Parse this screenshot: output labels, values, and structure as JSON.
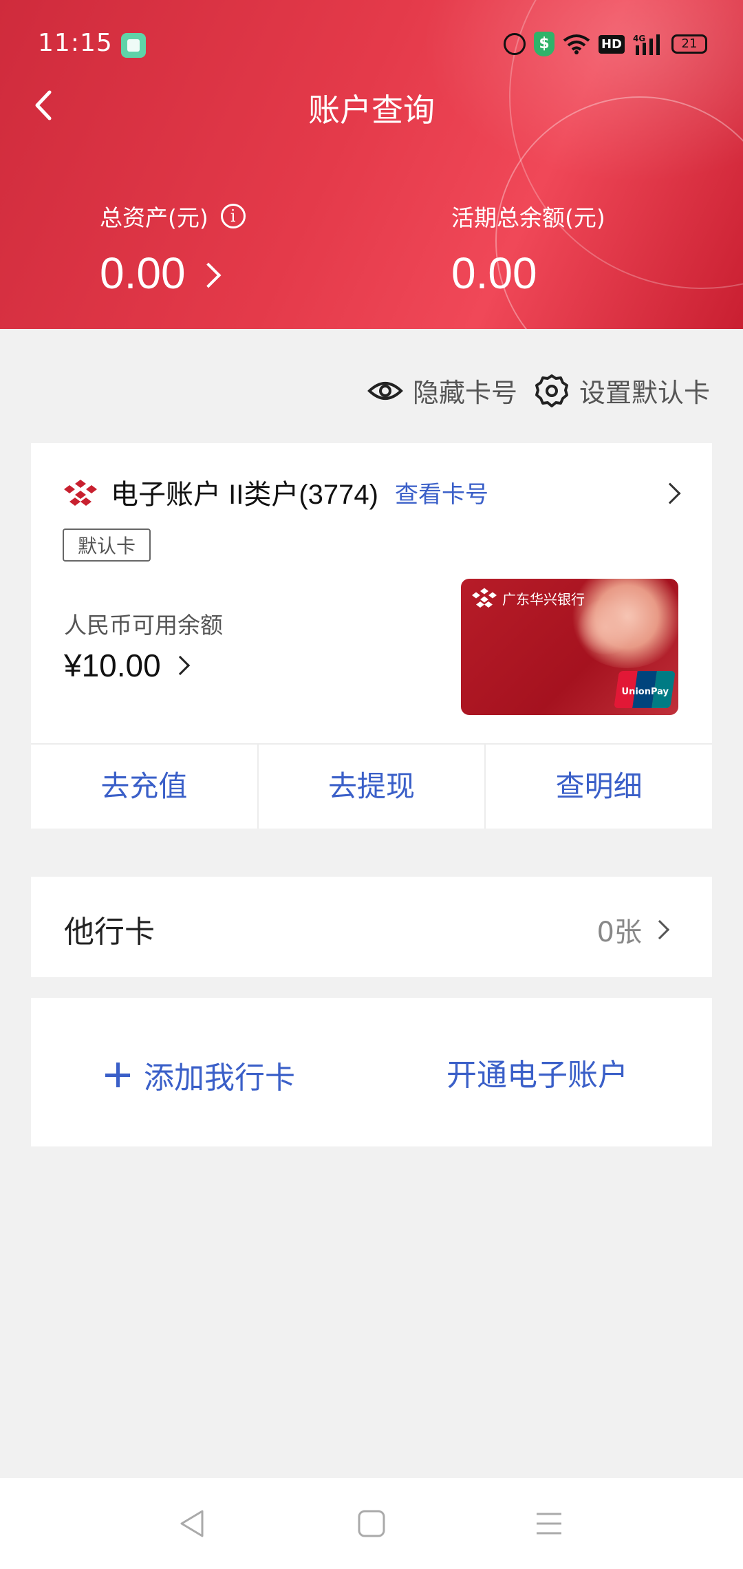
{
  "status_bar": {
    "time": "11:15",
    "hd_label": "HD",
    "signal_label": "4G",
    "battery": "21"
  },
  "header": {
    "title": "账户查询",
    "total_assets_label": "总资产(元)",
    "total_assets_value": "0.00",
    "current_balance_label": "活期总余额(元)",
    "current_balance_value": "0.00"
  },
  "options": {
    "hide_card_number": "隐藏卡号",
    "set_default_card": "设置默认卡"
  },
  "account_card": {
    "name": "电子账户 II类户(3774)",
    "view_card_number": "查看卡号",
    "default_tag": "默认卡",
    "balance_label": "人民币可用余额",
    "balance_value": "¥10.00",
    "card_bank_name": "广东华兴银行",
    "card_brand": "UnionPay"
  },
  "actions": [
    {
      "label": "去充值"
    },
    {
      "label": "去提现"
    },
    {
      "label": "查明细"
    }
  ],
  "other_cards": {
    "label": "他行卡",
    "count": "0张"
  },
  "add_panel": {
    "add_card": "添加我行卡",
    "open_account": "开通电子账户"
  },
  "colors": {
    "header_red": "#e03a4a",
    "link_blue": "#3a5fc8",
    "background": "#f1f1f1"
  }
}
